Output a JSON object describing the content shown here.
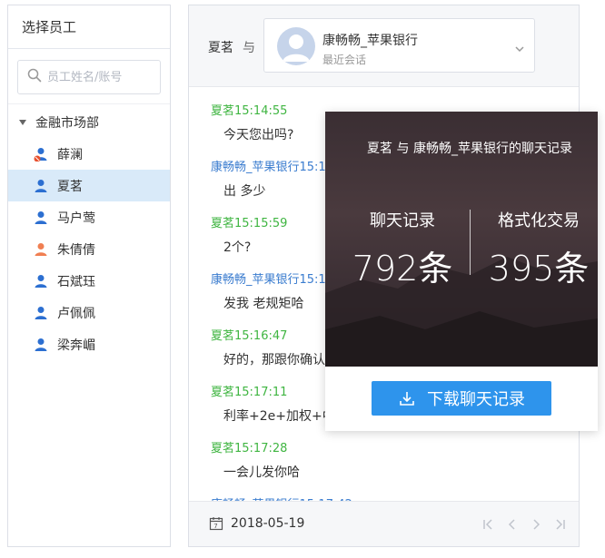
{
  "left": {
    "title": "选择员工",
    "search_placeholder": "员工姓名/账号",
    "department": "金融市场部",
    "employees": [
      {
        "name": "薛澜",
        "icon": "user-icon",
        "color": "#2c6fd1",
        "badge": true,
        "active": false
      },
      {
        "name": "夏茗",
        "icon": "user-icon",
        "color": "#2c6fd1",
        "badge": false,
        "active": true
      },
      {
        "name": "马户莺",
        "icon": "user-icon",
        "color": "#2c6fd1",
        "badge": false,
        "active": false
      },
      {
        "name": "朱倩倩",
        "icon": "user-icon",
        "color": "#f07f52",
        "badge": false,
        "active": false
      },
      {
        "name": "石斌珏",
        "icon": "user-icon",
        "color": "#2c6fd1",
        "badge": false,
        "active": false
      },
      {
        "name": "卢佩佩",
        "icon": "user-icon",
        "color": "#2c6fd1",
        "badge": false,
        "active": false
      },
      {
        "name": "梁奔嵋",
        "icon": "user-icon",
        "color": "#2c6fd1",
        "badge": false,
        "active": false
      }
    ]
  },
  "chat": {
    "self_name": "夏茗",
    "with_label": "与",
    "contact_name": "康畅畅_苹果银行",
    "contact_sub": "最近会话",
    "messages": [
      {
        "head": "夏茗15:14:55",
        "text": "今天您出吗?",
        "side": "green"
      },
      {
        "head": "康畅畅_苹果银行15:1",
        "text": "出 多少",
        "side": "blue"
      },
      {
        "head": "夏茗15:15:59",
        "text": "2个?",
        "side": "green"
      },
      {
        "head": "康畅畅_苹果银行15:1",
        "text": "发我 老规矩哈",
        "side": "blue"
      },
      {
        "head": "夏茗15:16:47",
        "text": "好的，那跟你确认",
        "side": "green"
      },
      {
        "head": "夏茗15:17:11",
        "text": "利率+2e+加权+中",
        "side": "green"
      },
      {
        "head": "夏茗15:17:28",
        "text": "一会儿发你哈",
        "side": "green"
      },
      {
        "head": "康畅畅_苹果银行15:17:42",
        "text": "",
        "side": "blue"
      }
    ],
    "footer_date": "2018-05-19"
  },
  "overlay": {
    "title": "夏茗 与 康畅畅_苹果银行的聊天记录",
    "left_label": "聊天记录",
    "left_value": "792条",
    "right_label": "格式化交易",
    "right_value": "395条",
    "download_label": "下载聊天记录"
  },
  "colors": {
    "accent": "#2e94ec",
    "green_text": "#3fb541",
    "blue_text": "#3a7ccf",
    "active_row": "#d9eaf9"
  }
}
